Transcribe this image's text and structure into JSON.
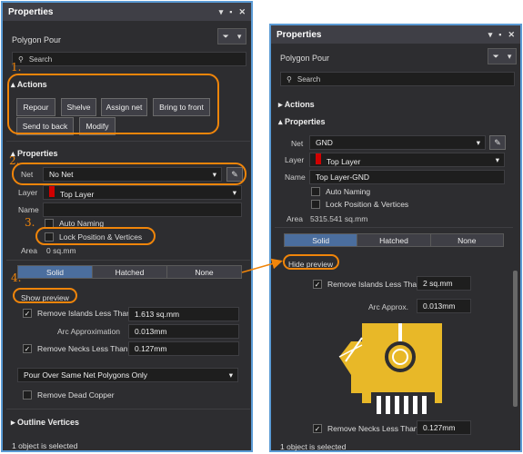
{
  "left": {
    "title": "Properties",
    "object_type": "Polygon Pour",
    "search_placeholder": "Search",
    "actions_header": "Actions",
    "buttons": [
      "Repour",
      "Shelve",
      "Assign net",
      "Bring to front",
      "Send to back",
      "Modify"
    ],
    "properties_header": "Properties",
    "net_label": "Net",
    "net_value": "No Net",
    "layer_label": "Layer",
    "layer_value": "Top Layer",
    "name_label": "Name",
    "name_value": "",
    "auto_naming": "Auto Naming",
    "lock_pos": "Lock Position & Vertices",
    "area_label": "Area",
    "area_value": "0 sq.mm",
    "fill_modes": [
      "Solid",
      "Hatched",
      "None"
    ],
    "show_preview": "Show preview",
    "remove_islands_label": "Remove Islands Less Than",
    "remove_islands_value": "1.613 sq.mm",
    "arc_label": "Arc Approximation",
    "arc_value": "0.013mm",
    "remove_necks_label": "Remove Necks Less Than",
    "remove_necks_value": "0.127mm",
    "pour_over": "Pour Over Same Net Polygons Only",
    "remove_dead": "Remove Dead Copper",
    "outline_header": "Outline Vertices",
    "status": "1 object is selected",
    "annotation_numbers": [
      "1.",
      "2.",
      "3.",
      "4."
    ]
  },
  "right": {
    "title": "Properties",
    "object_type": "Polygon Pour",
    "search_placeholder": "Search",
    "actions_header": "Actions",
    "properties_header": "Properties",
    "net_label": "Net",
    "net_value": "GND",
    "layer_label": "Layer",
    "layer_value": "Top Layer",
    "name_label": "Name",
    "name_value": "Top Layer-GND",
    "auto_naming": "Auto Naming",
    "lock_pos": "Lock Position & Vertices",
    "area_label": "Area",
    "area_value": "5315.541 sq.mm",
    "fill_modes": [
      "Solid",
      "Hatched",
      "None"
    ],
    "hide_preview": "Hide preview",
    "remove_islands_label": "Remove Islands Less Than",
    "remove_islands_value": "2 sq.mm",
    "arc_label": "Arc Approx.",
    "arc_value": "0.013mm",
    "remove_necks_label": "Remove Necks Less Than",
    "remove_necks_value": "0.127mm",
    "status": "1 object is selected"
  },
  "colors": {
    "accent": "#f0850a",
    "panel_border": "#5b9bd5",
    "layer_swatch": "#d00000",
    "copper": "#e8b828"
  }
}
